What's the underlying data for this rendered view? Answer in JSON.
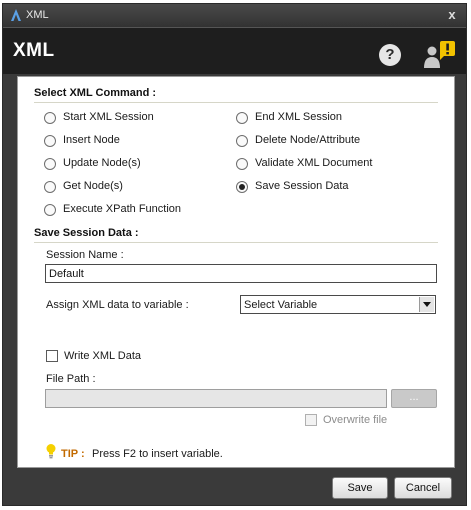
{
  "window": {
    "title": "XML",
    "close_glyph": "x"
  },
  "header": {
    "title": "XML",
    "help_glyph": "?"
  },
  "select_command": {
    "label": "Select XML Command :",
    "options": [
      {
        "label": "Start XML Session",
        "selected": false
      },
      {
        "label": "End XML Session",
        "selected": false
      },
      {
        "label": "Insert Node",
        "selected": false
      },
      {
        "label": "Delete Node/Attribute",
        "selected": false
      },
      {
        "label": "Update Node(s)",
        "selected": false
      },
      {
        "label": "Validate XML Document",
        "selected": false
      },
      {
        "label": "Get Node(s)",
        "selected": false
      },
      {
        "label": "Save Session Data",
        "selected": true
      },
      {
        "label": "Execute XPath Function",
        "selected": false
      }
    ]
  },
  "save_session": {
    "label": "Save Session Data :",
    "session_name_label": "Session Name :",
    "session_name_value": "Default",
    "assign_label": "Assign XML data to variable :",
    "variable_select": "Select Variable",
    "write_xml_label": "Write XML Data",
    "write_xml_checked": false,
    "file_path_label": "File Path :",
    "file_path_value": "",
    "browse_label": "...",
    "overwrite_label": "Overwrite file",
    "overwrite_checked": false
  },
  "tip": {
    "label": "TIP :",
    "text": "Press F2 to insert variable."
  },
  "footer": {
    "save_label": "Save",
    "cancel_label": "Cancel"
  },
  "colors": {
    "tip_accent": "#c26a00",
    "alert_yellow": "#f2c200",
    "window_chrome": "#3a3a3a"
  }
}
